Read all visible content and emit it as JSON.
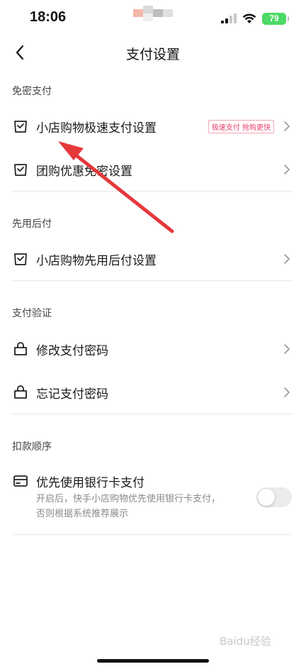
{
  "status_bar": {
    "time": "18:06",
    "battery": "79",
    "icons": [
      "signal-icon",
      "wifi-icon",
      "battery-charging-icon"
    ]
  },
  "nav": {
    "title": "支付设置",
    "back_icon": "chevron-left-icon"
  },
  "sections": [
    {
      "header": "免密支付",
      "items": [
        {
          "icon": "shopping-bag-check-icon",
          "label": "小店购物极速支付设置",
          "badge": "极速支付 抢购更快"
        },
        {
          "icon": "shopping-bag-check-icon",
          "label": "团购优惠免密设置"
        }
      ]
    },
    {
      "header": "先用后付",
      "items": [
        {
          "icon": "shopping-bag-check-icon",
          "label": "小店购物先用后付设置"
        }
      ]
    },
    {
      "header": "支付验证",
      "items": [
        {
          "icon": "lock-bag-icon",
          "label": "修改支付密码"
        },
        {
          "icon": "lock-bag-icon",
          "label": "忘记支付密码"
        }
      ]
    },
    {
      "header": "扣款顺序",
      "items": [
        {
          "icon": "bank-card-icon",
          "label": "优先使用银行卡支付",
          "description_line1": "开启后，快手小店购物优先使用银行卡支付，",
          "description_line2": "否则根据系统推荐展示",
          "toggle_on": false
        }
      ]
    }
  ],
  "colors": {
    "badge": "#e83d6a",
    "annotation_arrow": "#e5383b",
    "toggle_off": "#ececec"
  },
  "watermark": "Baidu经验"
}
